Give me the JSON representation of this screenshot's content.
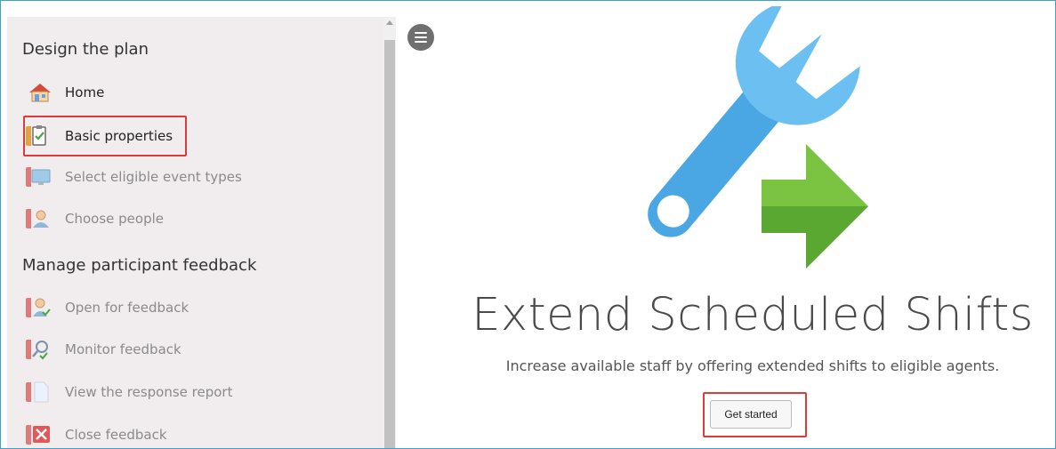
{
  "sidebar": {
    "sections": [
      {
        "title": "Design the plan",
        "items": [
          {
            "label": "Home",
            "icon": "home-icon",
            "enabled": true
          },
          {
            "label": "Basic properties",
            "icon": "clipboard-check-icon",
            "enabled": true,
            "highlighted": true
          },
          {
            "label": "Select eligible event types",
            "icon": "monitor-icon",
            "enabled": false
          },
          {
            "label": "Choose people",
            "icon": "person-icon",
            "enabled": false
          }
        ]
      },
      {
        "title": "Manage participant feedback",
        "items": [
          {
            "label": "Open for feedback",
            "icon": "person-check-icon",
            "enabled": false
          },
          {
            "label": "Monitor feedback",
            "icon": "magnifier-person-icon",
            "enabled": false
          },
          {
            "label": "View the response report",
            "icon": "document-icon",
            "enabled": false
          },
          {
            "label": "Close feedback",
            "icon": "red-x-icon",
            "enabled": false
          }
        ]
      }
    ]
  },
  "main": {
    "menu_icon": "hamburger-menu-icon",
    "hero_icon": "wrench-arrow-icon",
    "title": "Extend Scheduled Shifts",
    "subtitle": "Increase available staff by offering extended shifts to eligible agents.",
    "cta_label": "Get started"
  },
  "colors": {
    "highlight": "#e03b3b",
    "wrench": "#5ab3ea",
    "arrow": "#7bc441",
    "sidebar_bg": "#f1eced",
    "frame_border": "#3fa2c4"
  }
}
